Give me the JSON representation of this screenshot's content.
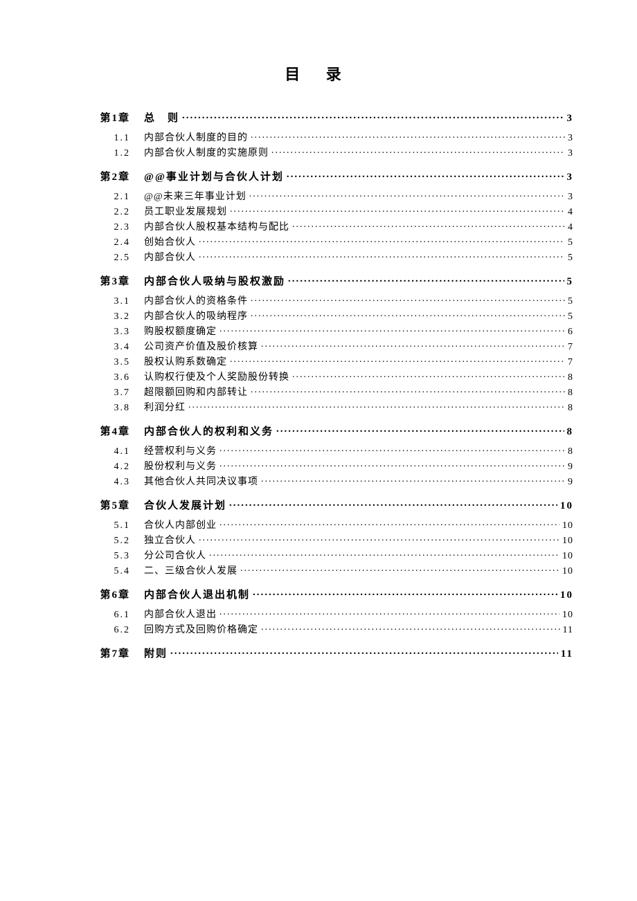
{
  "title": "目 录",
  "toc": [
    {
      "type": "chapter",
      "num": "第1章",
      "label": "总　则",
      "page": "3"
    },
    {
      "type": "sub",
      "num": "1.1",
      "label": "内部合伙人制度的目的",
      "page": "3"
    },
    {
      "type": "sub",
      "num": "1.2",
      "label": "内部合伙人制度的实施原则",
      "page": "3"
    },
    {
      "type": "chapter",
      "num": "第2章",
      "label": "@@事业计划与合伙人计划",
      "page": "3"
    },
    {
      "type": "sub",
      "num": "2.1",
      "label": "@@未来三年事业计划",
      "page": "3"
    },
    {
      "type": "sub",
      "num": "2.2",
      "label": "员工职业发展规划",
      "page": "4"
    },
    {
      "type": "sub",
      "num": "2.3",
      "label": "内部合伙人股权基本结构与配比",
      "page": "4"
    },
    {
      "type": "sub",
      "num": "2.4",
      "label": "创始合伙人",
      "page": "5"
    },
    {
      "type": "sub",
      "num": "2.5",
      "label": "内部合伙人",
      "page": "5"
    },
    {
      "type": "chapter",
      "num": "第3章",
      "label": "内部合伙人吸纳与股权激励",
      "page": "5"
    },
    {
      "type": "sub",
      "num": "3.1",
      "label": "内部合伙人的资格条件",
      "page": "5"
    },
    {
      "type": "sub",
      "num": "3.2",
      "label": "内部合伙人的吸纳程序",
      "page": "5"
    },
    {
      "type": "sub",
      "num": "3.3",
      "label": "购股权额度确定",
      "page": "6"
    },
    {
      "type": "sub",
      "num": "3.4",
      "label": "公司资产价值及股价核算",
      "page": "7"
    },
    {
      "type": "sub",
      "num": "3.5",
      "label": "股权认购系数确定",
      "page": "7"
    },
    {
      "type": "sub",
      "num": "3.6",
      "label": "认购权行使及个人奖励股份转换",
      "page": "8"
    },
    {
      "type": "sub",
      "num": "3.7",
      "label": "超限额回购和内部转让",
      "page": "8"
    },
    {
      "type": "sub",
      "num": "3.8",
      "label": "利润分红",
      "page": "8"
    },
    {
      "type": "chapter",
      "num": "第4章",
      "label": "内部合伙人的权利和义务",
      "page": "8"
    },
    {
      "type": "sub",
      "num": "4.1",
      "label": "经营权利与义务",
      "page": "8"
    },
    {
      "type": "sub",
      "num": "4.2",
      "label": "股份权利与义务",
      "page": "9"
    },
    {
      "type": "sub",
      "num": "4.3",
      "label": "其他合伙人共同决议事项",
      "page": "9"
    },
    {
      "type": "chapter",
      "num": "第5章",
      "label": "合伙人发展计划",
      "page": "10"
    },
    {
      "type": "sub",
      "num": "5.1",
      "label": "合伙人内部创业",
      "page": "10"
    },
    {
      "type": "sub",
      "num": "5.2",
      "label": "独立合伙人",
      "page": "10"
    },
    {
      "type": "sub",
      "num": "5.3",
      "label": "分公司合伙人",
      "page": "10"
    },
    {
      "type": "sub",
      "num": "5.4",
      "label": "二、三级合伙人发展",
      "page": "10"
    },
    {
      "type": "chapter",
      "num": "第6章",
      "label": "内部合伙人退出机制",
      "page": "10"
    },
    {
      "type": "sub",
      "num": "6.1",
      "label": "内部合伙人退出",
      "page": "10"
    },
    {
      "type": "sub",
      "num": "6.2",
      "label": "回购方式及回购价格确定",
      "page": "11"
    },
    {
      "type": "chapter",
      "num": "第7章",
      "label": "附则",
      "page": "11"
    }
  ]
}
